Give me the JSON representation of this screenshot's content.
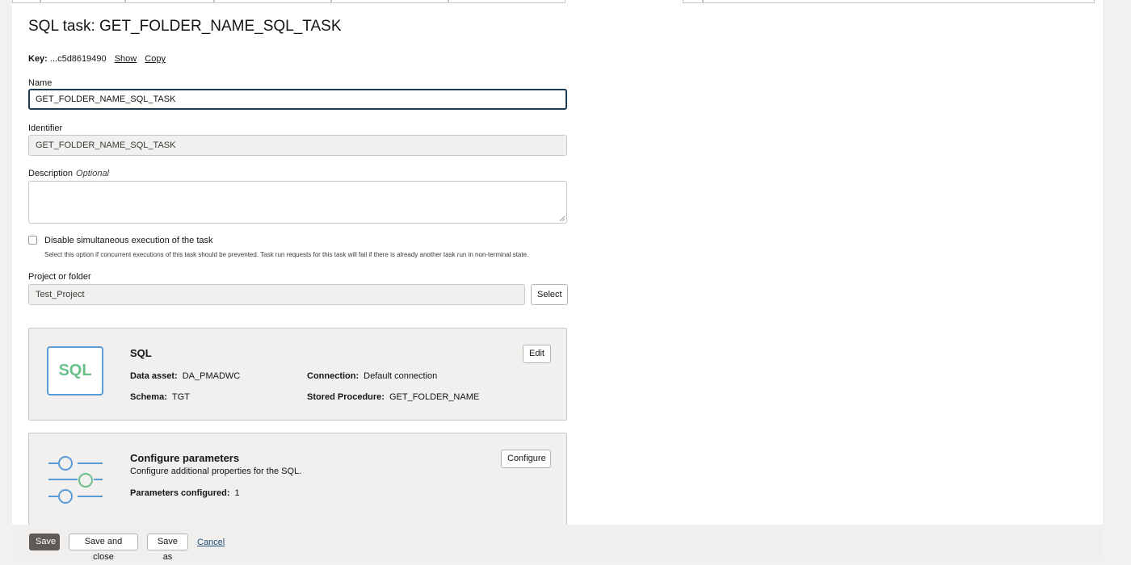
{
  "page": {
    "title": "SQL task: GET_FOLDER_NAME_SQL_TASK",
    "key_label": "Key:",
    "key_value": "...c5d8619490",
    "show_link": "Show",
    "copy_link": "Copy"
  },
  "form": {
    "name_label": "Name",
    "name_value": "GET_FOLDER_NAME_SQL_TASK",
    "identifier_label": "Identifier",
    "identifier_value": "GET_FOLDER_NAME_SQL_TASK",
    "description_label": "Description",
    "description_optional": "Optional",
    "disable_label": "Disable simultaneous execution of the task",
    "disable_help": "Select this option if concurrent executions of this task should be prevented. Task run requests for this task will fail if there is already another task run in non-terminal state.",
    "project_label": "Project or folder",
    "project_value": "Test_Project",
    "select_button": "Select"
  },
  "sql_card": {
    "icon_text": "SQL",
    "title": "SQL",
    "edit_button": "Edit",
    "data_asset_label": "Data asset:",
    "data_asset_value": "DA_PMADWC",
    "connection_label": "Connection:",
    "connection_value": "Default connection",
    "schema_label": "Schema:",
    "schema_value": "TGT",
    "stored_procedure_label": "Stored Procedure:",
    "stored_procedure_value": "GET_FOLDER_NAME"
  },
  "params_card": {
    "icon": "sliders-icon",
    "title": "Configure parameters",
    "subtitle": "Configure additional properties for the SQL.",
    "configure_button": "Configure",
    "configured_label": "Parameters configured:",
    "configured_value": "1"
  },
  "footer": {
    "save": "Save",
    "save_close": "Save and close",
    "save_as": "Save as",
    "cancel": "Cancel"
  },
  "colors": {
    "primary_button": "#5f5a56",
    "sql_icon_border": "#5b9bd5",
    "sql_icon_text": "#6abf8b",
    "link": "#1f4e79"
  }
}
